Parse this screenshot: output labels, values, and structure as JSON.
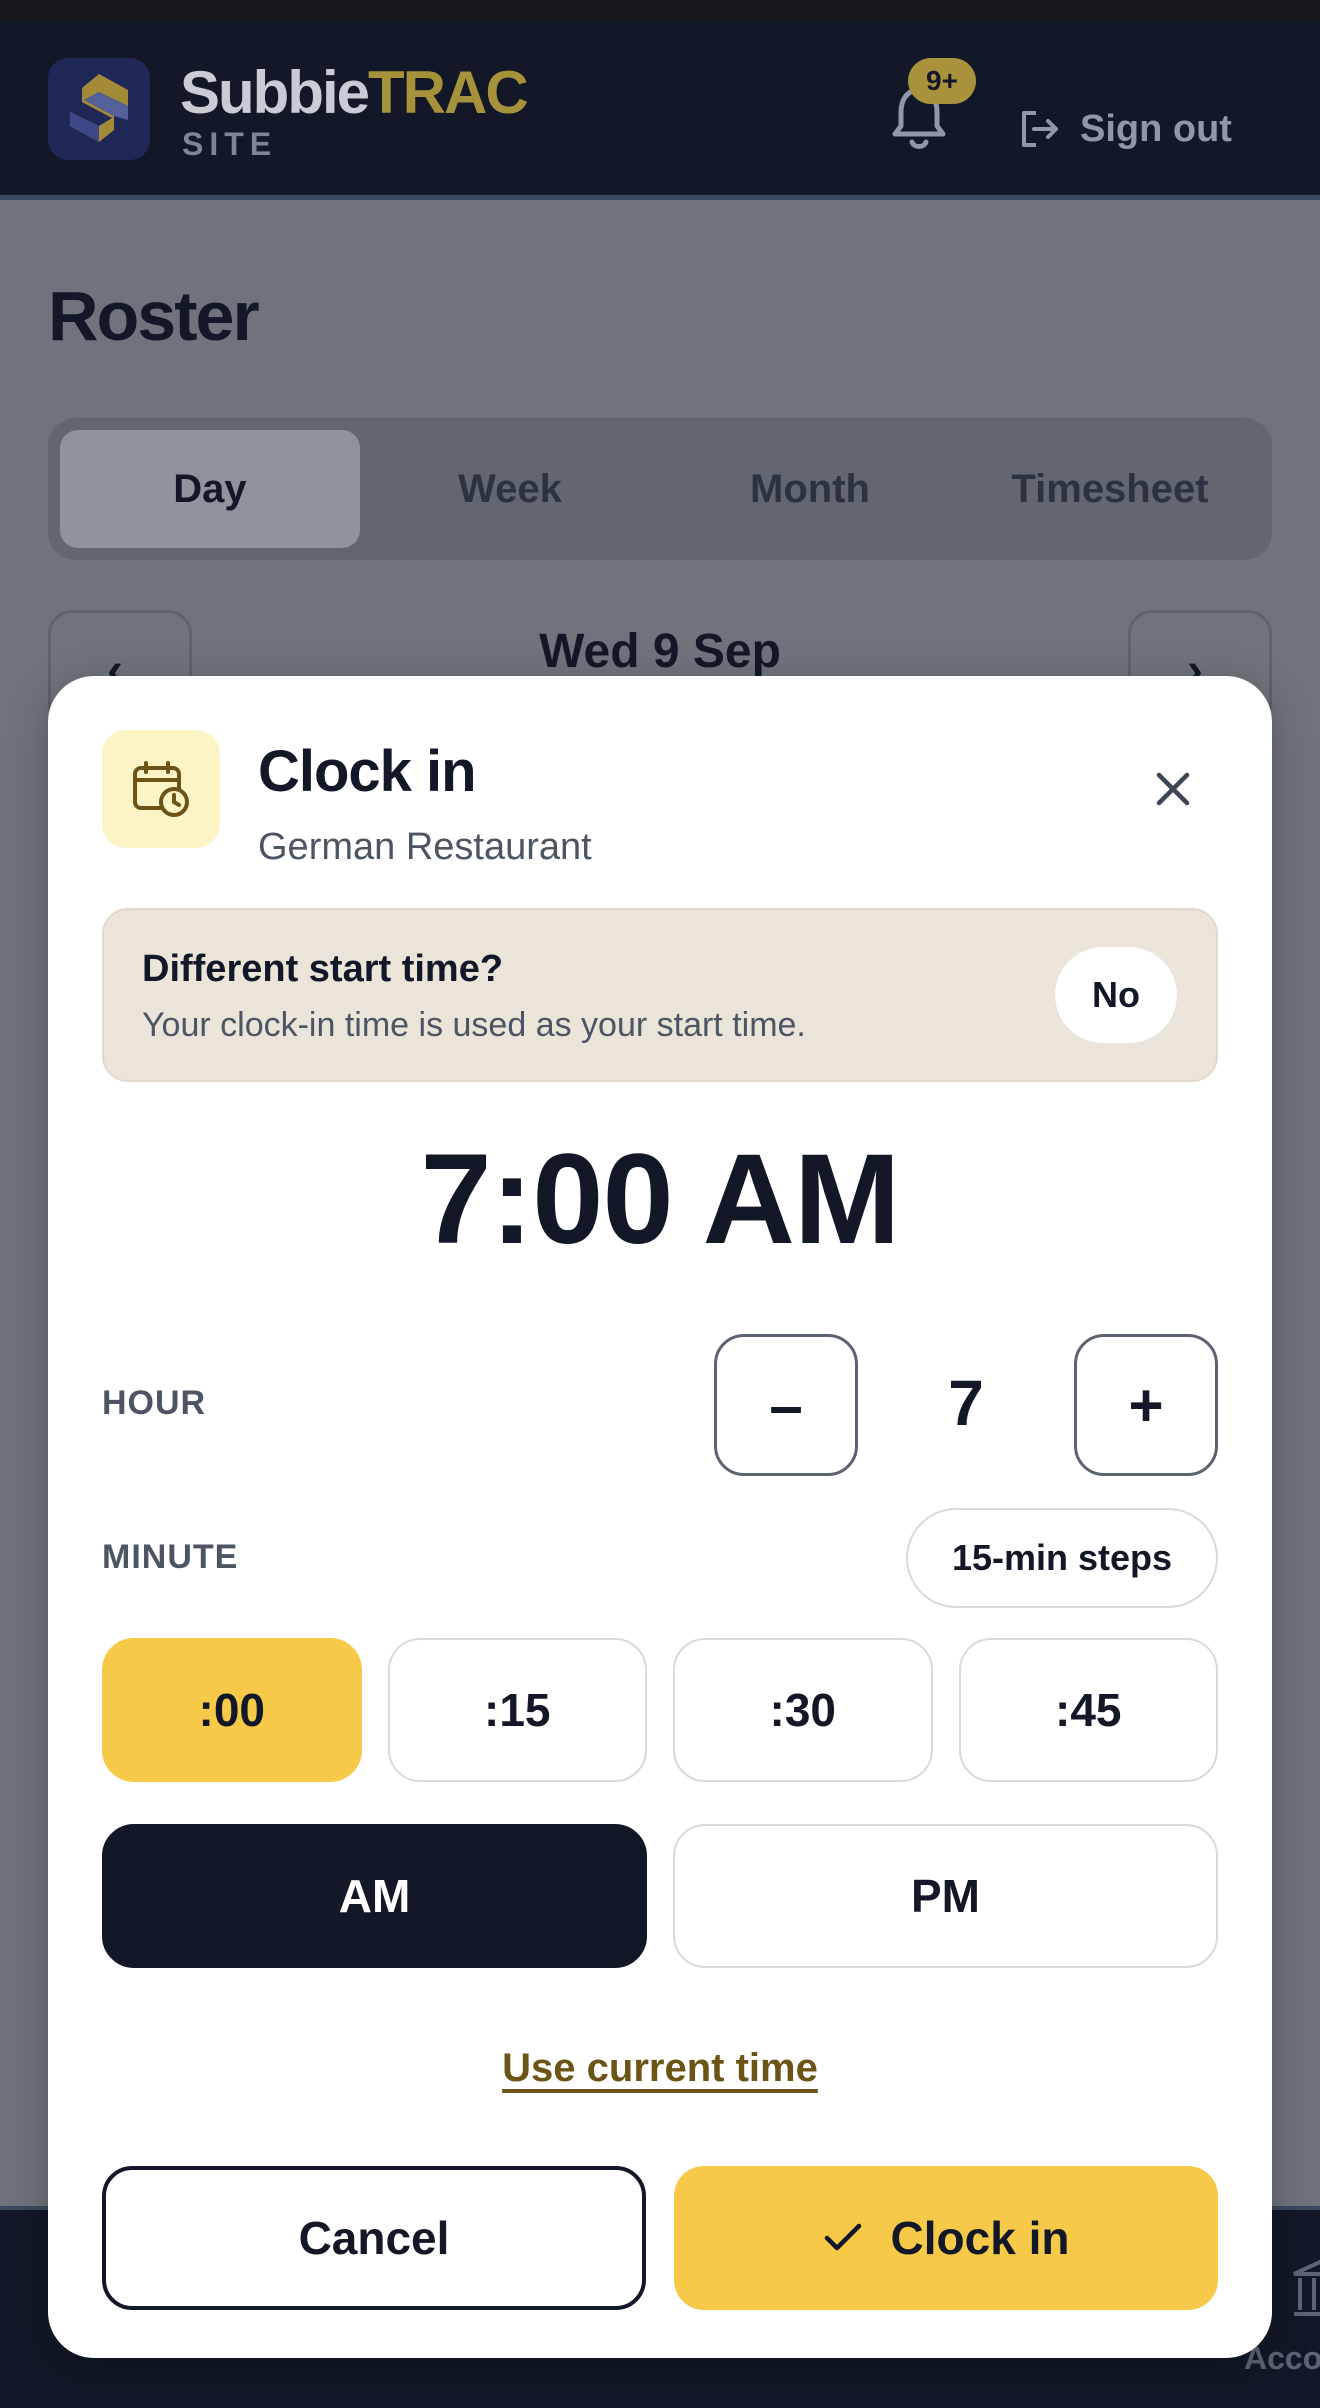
{
  "app": {
    "brand_main": "Subbie",
    "brand_accent": "TRAC",
    "brand_sub": "SITE",
    "notification_badge": "9+",
    "sign_out_label": "Sign out"
  },
  "page": {
    "title": "Roster",
    "tabs": [
      {
        "label": "Day",
        "active": true
      },
      {
        "label": "Week",
        "active": false
      },
      {
        "label": "Month",
        "active": false
      },
      {
        "label": "Timesheet",
        "active": false
      }
    ],
    "date_label": "Wed 9 Sep",
    "prev_icon": "chevron-left-icon",
    "next_icon": "chevron-right-icon"
  },
  "bottom_nav": {
    "partial_label": "Acco"
  },
  "modal": {
    "title": "Clock in",
    "subtitle": "German Restaurant",
    "icon": "calendar-clock-icon",
    "alt_start": {
      "title": "Different start time?",
      "description": "Your clock-in time is used as your start time.",
      "toggle_label": "No"
    },
    "time_display": "7:00 AM",
    "hour": {
      "label": "HOUR",
      "value": "7",
      "minus_label": "–",
      "plus_label": "+"
    },
    "minute": {
      "label": "MINUTE",
      "steps_label": "15-min steps",
      "options": [
        {
          "label": ":00",
          "active": true
        },
        {
          "label": ":15",
          "active": false
        },
        {
          "label": ":30",
          "active": false
        },
        {
          "label": ":45",
          "active": false
        }
      ]
    },
    "period": {
      "options": [
        {
          "label": "AM",
          "active": true
        },
        {
          "label": "PM",
          "active": false
        }
      ]
    },
    "use_current_label": "Use current time",
    "cancel_label": "Cancel",
    "confirm_label": "Clock in"
  },
  "colors": {
    "accent_yellow": "#f7c948",
    "dark_navy": "#121827",
    "panel_beige": "#ebe4d9"
  }
}
